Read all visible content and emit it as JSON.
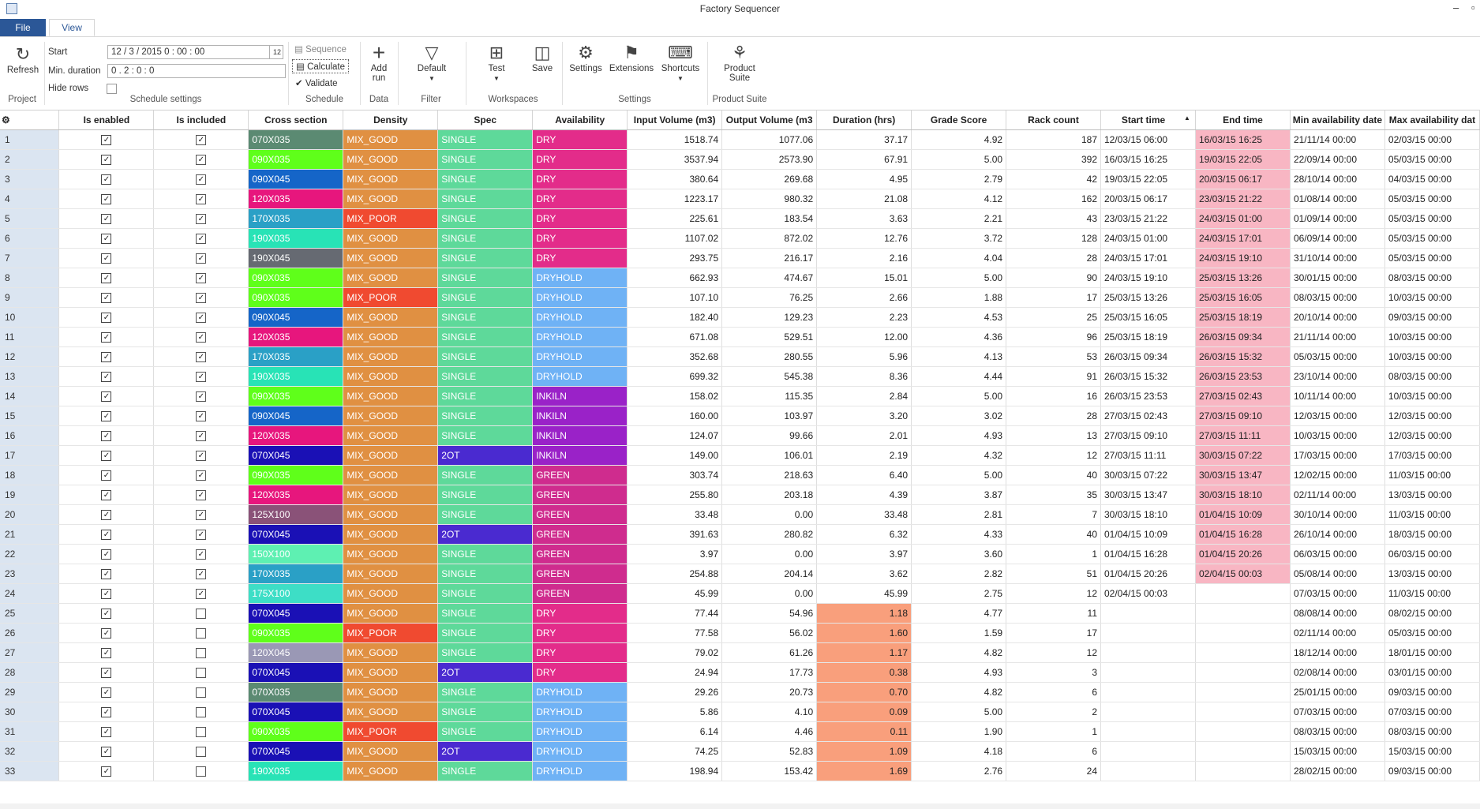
{
  "app": {
    "title": "Factory Sequencer"
  },
  "tabs": {
    "file": "File",
    "view": "View"
  },
  "ribbon": {
    "project": {
      "refresh": "Refresh",
      "group": "Project"
    },
    "schedule_settings": {
      "start_label": "Start",
      "start_value": "12 / 3 /  2015    0 : 00 : 00",
      "cal": "12",
      "min_duration_label": "Min. duration",
      "min_duration_value": "0 . 2 : 0 : 0",
      "hide_rows_label": "Hide rows",
      "group": "Schedule settings"
    },
    "schedule": {
      "sequence": "Sequence",
      "calculate": "Calculate",
      "validate": "Validate",
      "group": "Schedule"
    },
    "data": {
      "add_run": "Add run",
      "group": "Data"
    },
    "filter": {
      "default": "Default",
      "group": "Filter"
    },
    "workspaces": {
      "test": "Test",
      "save": "Save",
      "group": "Workspaces"
    },
    "settings": {
      "settings": "Settings",
      "extensions": "Extensions",
      "shortcuts": "Shortcuts",
      "group": "Settings"
    },
    "product_suite": {
      "label": "Product Suite",
      "group": "Product Suite"
    }
  },
  "grid": {
    "columns": [
      "Is enabled",
      "Is included",
      "Cross section",
      "Density",
      "Spec",
      "Availability",
      "Input Volume (m3)",
      "Output Volume (m3",
      "Duration (hrs)",
      "Grade Score",
      "Rack count",
      "Start time",
      "End time",
      "Min availability date",
      "Max availability dat"
    ],
    "colors": {
      "070X035": "#5b8a72",
      "090X035": "#5fff1a",
      "090X045": "#1565c8",
      "120X035": "#e7167d",
      "170X035": "#2aa0c6",
      "190X035": "#28e3b6",
      "190X045": "#666a72",
      "070X045": "#1a10b5",
      "125X100": "#8a5278",
      "150X100": "#5ef0b2",
      "175X100": "#3ddec6",
      "120X045": "#9a98b5",
      "MIX_GOOD": "#e09042",
      "MIX_POOR": "#f04a30",
      "SINGLE": "#5ed99a",
      "2OT": "#4a2ad0",
      "DRY": "#e32c8a",
      "DRYHOLD": "#6fb2f5",
      "INKILN": "#9a22c8",
      "GREEN": "#cf2c8e",
      "endtime": "#f8b6c3",
      "shortdur": "#f99f7c"
    },
    "rows": [
      {
        "n": "1",
        "en": true,
        "inc": true,
        "cs": "070X035",
        "den": "MIX_GOOD",
        "spec": "SINGLE",
        "av": "DRY",
        "iv": "1518.74",
        "ov": "1077.06",
        "dur": "37.17",
        "gs": "4.92",
        "rc": "187",
        "st": "12/03/15 06:00",
        "et": "16/03/15 16:25",
        "mn": "21/11/14 00:00",
        "mx": "02/03/15 00:00"
      },
      {
        "n": "2",
        "en": true,
        "inc": true,
        "cs": "090X035",
        "den": "MIX_GOOD",
        "spec": "SINGLE",
        "av": "DRY",
        "iv": "3537.94",
        "ov": "2573.90",
        "dur": "67.91",
        "gs": "5.00",
        "rc": "392",
        "st": "16/03/15 16:25",
        "et": "19/03/15 22:05",
        "mn": "22/09/14 00:00",
        "mx": "05/03/15 00:00"
      },
      {
        "n": "3",
        "en": true,
        "inc": true,
        "cs": "090X045",
        "den": "MIX_GOOD",
        "spec": "SINGLE",
        "av": "DRY",
        "iv": "380.64",
        "ov": "269.68",
        "dur": "4.95",
        "gs": "2.79",
        "rc": "42",
        "st": "19/03/15 22:05",
        "et": "20/03/15 06:17",
        "mn": "28/10/14 00:00",
        "mx": "04/03/15 00:00"
      },
      {
        "n": "4",
        "en": true,
        "inc": true,
        "cs": "120X035",
        "den": "MIX_GOOD",
        "spec": "SINGLE",
        "av": "DRY",
        "iv": "1223.17",
        "ov": "980.32",
        "dur": "21.08",
        "gs": "4.12",
        "rc": "162",
        "st": "20/03/15 06:17",
        "et": "23/03/15 21:22",
        "mn": "01/08/14 00:00",
        "mx": "05/03/15 00:00"
      },
      {
        "n": "5",
        "en": true,
        "inc": true,
        "cs": "170X035",
        "den": "MIX_POOR",
        "spec": "SINGLE",
        "av": "DRY",
        "iv": "225.61",
        "ov": "183.54",
        "dur": "3.63",
        "gs": "2.21",
        "rc": "43",
        "st": "23/03/15 21:22",
        "et": "24/03/15 01:00",
        "mn": "01/09/14 00:00",
        "mx": "05/03/15 00:00"
      },
      {
        "n": "6",
        "en": true,
        "inc": true,
        "cs": "190X035",
        "den": "MIX_GOOD",
        "spec": "SINGLE",
        "av": "DRY",
        "iv": "1107.02",
        "ov": "872.02",
        "dur": "12.76",
        "gs": "3.72",
        "rc": "128",
        "st": "24/03/15 01:00",
        "et": "24/03/15 17:01",
        "mn": "06/09/14 00:00",
        "mx": "05/03/15 00:00"
      },
      {
        "n": "7",
        "en": true,
        "inc": true,
        "cs": "190X045",
        "den": "MIX_GOOD",
        "spec": "SINGLE",
        "av": "DRY",
        "iv": "293.75",
        "ov": "216.17",
        "dur": "2.16",
        "gs": "4.04",
        "rc": "28",
        "st": "24/03/15 17:01",
        "et": "24/03/15 19:10",
        "mn": "31/10/14 00:00",
        "mx": "05/03/15 00:00"
      },
      {
        "n": "8",
        "en": true,
        "inc": true,
        "cs": "090X035",
        "den": "MIX_GOOD",
        "spec": "SINGLE",
        "av": "DRYHOLD",
        "iv": "662.93",
        "ov": "474.67",
        "dur": "15.01",
        "gs": "5.00",
        "rc": "90",
        "st": "24/03/15 19:10",
        "et": "25/03/15 13:26",
        "mn": "30/01/15 00:00",
        "mx": "08/03/15 00:00"
      },
      {
        "n": "9",
        "en": true,
        "inc": true,
        "cs": "090X035",
        "den": "MIX_POOR",
        "spec": "SINGLE",
        "av": "DRYHOLD",
        "iv": "107.10",
        "ov": "76.25",
        "dur": "2.66",
        "gs": "1.88",
        "rc": "17",
        "st": "25/03/15 13:26",
        "et": "25/03/15 16:05",
        "mn": "08/03/15 00:00",
        "mx": "10/03/15 00:00"
      },
      {
        "n": "10",
        "en": true,
        "inc": true,
        "cs": "090X045",
        "den": "MIX_GOOD",
        "spec": "SINGLE",
        "av": "DRYHOLD",
        "iv": "182.40",
        "ov": "129.23",
        "dur": "2.23",
        "gs": "4.53",
        "rc": "25",
        "st": "25/03/15 16:05",
        "et": "25/03/15 18:19",
        "mn": "20/10/14 00:00",
        "mx": "09/03/15 00:00"
      },
      {
        "n": "11",
        "en": true,
        "inc": true,
        "cs": "120X035",
        "den": "MIX_GOOD",
        "spec": "SINGLE",
        "av": "DRYHOLD",
        "iv": "671.08",
        "ov": "529.51",
        "dur": "12.00",
        "gs": "4.36",
        "rc": "96",
        "st": "25/03/15 18:19",
        "et": "26/03/15 09:34",
        "mn": "21/11/14 00:00",
        "mx": "10/03/15 00:00"
      },
      {
        "n": "12",
        "en": true,
        "inc": true,
        "cs": "170X035",
        "den": "MIX_GOOD",
        "spec": "SINGLE",
        "av": "DRYHOLD",
        "iv": "352.68",
        "ov": "280.55",
        "dur": "5.96",
        "gs": "4.13",
        "rc": "53",
        "st": "26/03/15 09:34",
        "et": "26/03/15 15:32",
        "mn": "05/03/15 00:00",
        "mx": "10/03/15 00:00"
      },
      {
        "n": "13",
        "en": true,
        "inc": true,
        "cs": "190X035",
        "den": "MIX_GOOD",
        "spec": "SINGLE",
        "av": "DRYHOLD",
        "iv": "699.32",
        "ov": "545.38",
        "dur": "8.36",
        "gs": "4.44",
        "rc": "91",
        "st": "26/03/15 15:32",
        "et": "26/03/15 23:53",
        "mn": "23/10/14 00:00",
        "mx": "08/03/15 00:00"
      },
      {
        "n": "14",
        "en": true,
        "inc": true,
        "cs": "090X035",
        "den": "MIX_GOOD",
        "spec": "SINGLE",
        "av": "INKILN",
        "iv": "158.02",
        "ov": "115.35",
        "dur": "2.84",
        "gs": "5.00",
        "rc": "16",
        "st": "26/03/15 23:53",
        "et": "27/03/15 02:43",
        "mn": "10/11/14 00:00",
        "mx": "10/03/15 00:00"
      },
      {
        "n": "15",
        "en": true,
        "inc": true,
        "cs": "090X045",
        "den": "MIX_GOOD",
        "spec": "SINGLE",
        "av": "INKILN",
        "iv": "160.00",
        "ov": "103.97",
        "dur": "3.20",
        "gs": "3.02",
        "rc": "28",
        "st": "27/03/15 02:43",
        "et": "27/03/15 09:10",
        "mn": "12/03/15 00:00",
        "mx": "12/03/15 00:00"
      },
      {
        "n": "16",
        "en": true,
        "inc": true,
        "cs": "120X035",
        "den": "MIX_GOOD",
        "spec": "SINGLE",
        "av": "INKILN",
        "iv": "124.07",
        "ov": "99.66",
        "dur": "2.01",
        "gs": "4.93",
        "rc": "13",
        "st": "27/03/15 09:10",
        "et": "27/03/15 11:11",
        "mn": "10/03/15 00:00",
        "mx": "12/03/15 00:00"
      },
      {
        "n": "17",
        "en": true,
        "inc": true,
        "cs": "070X045",
        "den": "MIX_GOOD",
        "spec": "2OT",
        "av": "INKILN",
        "iv": "149.00",
        "ov": "106.01",
        "dur": "2.19",
        "gs": "4.32",
        "rc": "12",
        "st": "27/03/15 11:11",
        "et": "30/03/15 07:22",
        "mn": "17/03/15 00:00",
        "mx": "17/03/15 00:00"
      },
      {
        "n": "18",
        "en": true,
        "inc": true,
        "cs": "090X035",
        "den": "MIX_GOOD",
        "spec": "SINGLE",
        "av": "GREEN",
        "iv": "303.74",
        "ov": "218.63",
        "dur": "6.40",
        "gs": "5.00",
        "rc": "40",
        "st": "30/03/15 07:22",
        "et": "30/03/15 13:47",
        "mn": "12/02/15 00:00",
        "mx": "11/03/15 00:00"
      },
      {
        "n": "19",
        "en": true,
        "inc": true,
        "cs": "120X035",
        "den": "MIX_GOOD",
        "spec": "SINGLE",
        "av": "GREEN",
        "iv": "255.80",
        "ov": "203.18",
        "dur": "4.39",
        "gs": "3.87",
        "rc": "35",
        "st": "30/03/15 13:47",
        "et": "30/03/15 18:10",
        "mn": "02/11/14 00:00",
        "mx": "13/03/15 00:00"
      },
      {
        "n": "20",
        "en": true,
        "inc": true,
        "cs": "125X100",
        "den": "MIX_GOOD",
        "spec": "SINGLE",
        "av": "GREEN",
        "iv": "33.48",
        "ov": "0.00",
        "dur": "33.48",
        "gs": "2.81",
        "rc": "7",
        "st": "30/03/15 18:10",
        "et": "01/04/15 10:09",
        "mn": "30/10/14 00:00",
        "mx": "11/03/15 00:00"
      },
      {
        "n": "21",
        "en": true,
        "inc": true,
        "cs": "070X045",
        "den": "MIX_GOOD",
        "spec": "2OT",
        "av": "GREEN",
        "iv": "391.63",
        "ov": "280.82",
        "dur": "6.32",
        "gs": "4.33",
        "rc": "40",
        "st": "01/04/15 10:09",
        "et": "01/04/15 16:28",
        "mn": "26/10/14 00:00",
        "mx": "18/03/15 00:00"
      },
      {
        "n": "22",
        "en": true,
        "inc": true,
        "cs": "150X100",
        "den": "MIX_GOOD",
        "spec": "SINGLE",
        "av": "GREEN",
        "iv": "3.97",
        "ov": "0.00",
        "dur": "3.97",
        "gs": "3.60",
        "rc": "1",
        "st": "01/04/15 16:28",
        "et": "01/04/15 20:26",
        "mn": "06/03/15 00:00",
        "mx": "06/03/15 00:00"
      },
      {
        "n": "23",
        "en": true,
        "inc": true,
        "cs": "170X035",
        "den": "MIX_GOOD",
        "spec": "SINGLE",
        "av": "GREEN",
        "iv": "254.88",
        "ov": "204.14",
        "dur": "3.62",
        "gs": "2.82",
        "rc": "51",
        "st": "01/04/15 20:26",
        "et": "02/04/15 00:03",
        "mn": "05/08/14 00:00",
        "mx": "13/03/15 00:00"
      },
      {
        "n": "24",
        "en": true,
        "inc": true,
        "cs": "175X100",
        "den": "MIX_GOOD",
        "spec": "SINGLE",
        "av": "GREEN",
        "iv": "45.99",
        "ov": "0.00",
        "dur": "45.99",
        "gs": "2.75",
        "rc": "12",
        "st": "02/04/15 00:03",
        "et": "",
        "mn": "07/03/15 00:00",
        "mx": "11/03/15 00:00"
      },
      {
        "n": "25",
        "en": true,
        "inc": false,
        "cs": "070X045",
        "den": "MIX_GOOD",
        "spec": "SINGLE",
        "av": "DRY",
        "iv": "77.44",
        "ov": "54.96",
        "dur": "1.18",
        "gs": "4.77",
        "rc": "11",
        "st": "",
        "et": "",
        "mn": "08/08/14 00:00",
        "mx": "08/02/15 00:00",
        "short": true
      },
      {
        "n": "26",
        "en": true,
        "inc": false,
        "cs": "090X035",
        "den": "MIX_POOR",
        "spec": "SINGLE",
        "av": "DRY",
        "iv": "77.58",
        "ov": "56.02",
        "dur": "1.60",
        "gs": "1.59",
        "rc": "17",
        "st": "",
        "et": "",
        "mn": "02/11/14 00:00",
        "mx": "05/03/15 00:00",
        "short": true
      },
      {
        "n": "27",
        "en": true,
        "inc": false,
        "cs": "120X045",
        "den": "MIX_GOOD",
        "spec": "SINGLE",
        "av": "DRY",
        "iv": "79.02",
        "ov": "61.26",
        "dur": "1.17",
        "gs": "4.82",
        "rc": "12",
        "st": "",
        "et": "",
        "mn": "18/12/14 00:00",
        "mx": "18/01/15 00:00",
        "short": true
      },
      {
        "n": "28",
        "en": true,
        "inc": false,
        "cs": "070X045",
        "den": "MIX_GOOD",
        "spec": "2OT",
        "av": "DRY",
        "iv": "24.94",
        "ov": "17.73",
        "dur": "0.38",
        "gs": "4.93",
        "rc": "3",
        "st": "",
        "et": "",
        "mn": "02/08/14 00:00",
        "mx": "03/01/15 00:00",
        "short": true
      },
      {
        "n": "29",
        "en": true,
        "inc": false,
        "cs": "070X035",
        "den": "MIX_GOOD",
        "spec": "SINGLE",
        "av": "DRYHOLD",
        "iv": "29.26",
        "ov": "20.73",
        "dur": "0.70",
        "gs": "4.82",
        "rc": "6",
        "st": "",
        "et": "",
        "mn": "25/01/15 00:00",
        "mx": "09/03/15 00:00",
        "short": true
      },
      {
        "n": "30",
        "en": true,
        "inc": false,
        "cs": "070X045",
        "den": "MIX_GOOD",
        "spec": "SINGLE",
        "av": "DRYHOLD",
        "iv": "5.86",
        "ov": "4.10",
        "dur": "0.09",
        "gs": "5.00",
        "rc": "2",
        "st": "",
        "et": "",
        "mn": "07/03/15 00:00",
        "mx": "07/03/15 00:00",
        "short": true
      },
      {
        "n": "31",
        "en": true,
        "inc": false,
        "cs": "090X035",
        "den": "MIX_POOR",
        "spec": "SINGLE",
        "av": "DRYHOLD",
        "iv": "6.14",
        "ov": "4.46",
        "dur": "0.11",
        "gs": "1.90",
        "rc": "1",
        "st": "",
        "et": "",
        "mn": "08/03/15 00:00",
        "mx": "08/03/15 00:00",
        "short": true
      },
      {
        "n": "32",
        "en": true,
        "inc": false,
        "cs": "070X045",
        "den": "MIX_GOOD",
        "spec": "2OT",
        "av": "DRYHOLD",
        "iv": "74.25",
        "ov": "52.83",
        "dur": "1.09",
        "gs": "4.18",
        "rc": "6",
        "st": "",
        "et": "",
        "mn": "15/03/15 00:00",
        "mx": "15/03/15 00:00",
        "short": true
      },
      {
        "n": "33",
        "en": true,
        "inc": false,
        "cs": "190X035",
        "den": "MIX_GOOD",
        "spec": "SINGLE",
        "av": "DRYHOLD",
        "iv": "198.94",
        "ov": "153.42",
        "dur": "1.69",
        "gs": "2.76",
        "rc": "24",
        "st": "",
        "et": "",
        "mn": "28/02/15 00:00",
        "mx": "09/03/15 00:00",
        "short": true
      }
    ]
  }
}
